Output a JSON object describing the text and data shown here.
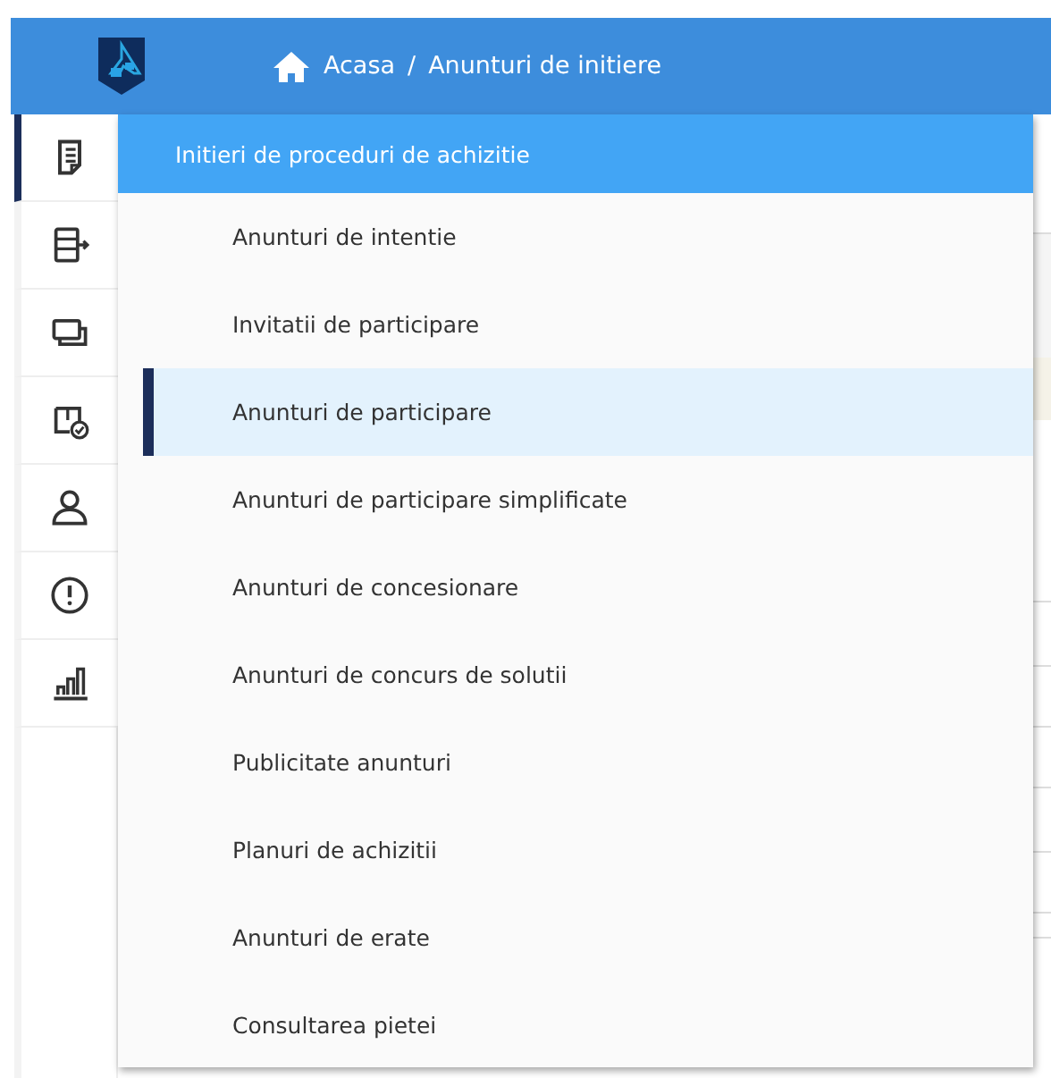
{
  "header": {
    "breadcrumb": [
      {
        "label": "Acasa",
        "kind": "home"
      },
      {
        "label": "Anunturi de initiere",
        "kind": "page"
      }
    ],
    "separator": "/"
  },
  "sidebar": {
    "items": [
      {
        "kind": "document",
        "selected": true
      },
      {
        "kind": "export",
        "selected": false
      },
      {
        "kind": "stack",
        "selected": false
      },
      {
        "kind": "shield",
        "selected": false
      },
      {
        "kind": "person",
        "selected": false
      },
      {
        "kind": "alert",
        "selected": false
      },
      {
        "kind": "chart",
        "selected": false
      }
    ]
  },
  "menu": {
    "title": "Initieri de proceduri de achizitie",
    "items": [
      {
        "label": "Anunturi de intentie",
        "selected": false
      },
      {
        "label": "Invitatii de participare",
        "selected": false
      },
      {
        "label": "Anunturi de participare",
        "selected": true
      },
      {
        "label": "Anunturi de participare simplificate",
        "selected": false
      },
      {
        "label": "Anunturi de concesionare",
        "selected": false
      },
      {
        "label": "Anunturi de concurs de solutii",
        "selected": false
      },
      {
        "label": "Publicitate anunturi",
        "selected": false
      },
      {
        "label": "Planuri de achizitii",
        "selected": false
      },
      {
        "label": "Anunturi de erate",
        "selected": false
      },
      {
        "label": "Consultarea pietei",
        "selected": false
      }
    ]
  }
}
